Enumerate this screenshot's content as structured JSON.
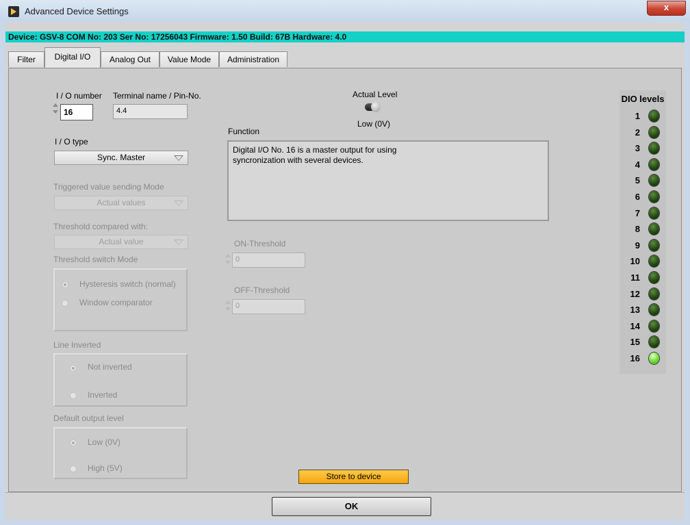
{
  "window": {
    "title": "Advanced Device Settings",
    "close_label": "x"
  },
  "device_info": "Device: GSV-8 COM No: 203 Ser No: 17256043 Firmware: 1.50 Build: 67B Hardware: 4.0",
  "tabs": [
    {
      "label": "Filter",
      "active": false
    },
    {
      "label": "Digital I/O",
      "active": true
    },
    {
      "label": "Analog Out",
      "active": false
    },
    {
      "label": "Value Mode",
      "active": false
    },
    {
      "label": "Administration",
      "active": false
    }
  ],
  "io": {
    "number_label": "I / O number",
    "number_value": "16",
    "terminal_label": "Terminal name / Pin-No.",
    "terminal_value": "4.4",
    "type_label": "I / O type",
    "type_value": "Sync. Master"
  },
  "triggered": {
    "label": "Triggered value sending Mode",
    "value": "Actual values"
  },
  "threshold_compare": {
    "label": "Threshold compared with:",
    "value": "Actual value"
  },
  "threshold_switch": {
    "label": "Threshold switch Mode",
    "options": [
      "Hysteresis switch (normal)",
      "Window comparator"
    ],
    "selected": 0
  },
  "line_inverted": {
    "label": "Line Inverted",
    "options": [
      "Not inverted",
      "Inverted"
    ],
    "selected": 0
  },
  "default_output": {
    "label": "Default output level",
    "options": [
      "Low (0V)",
      "High (5V)"
    ],
    "selected": 0
  },
  "actual_level": {
    "label": "Actual Level",
    "value": "Low (0V)"
  },
  "function": {
    "label": "Function",
    "text": "Digital I/O No. 16 is a  master output for using\nsyncronization with several devices."
  },
  "on_threshold": {
    "label": "ON-Threshold",
    "value": "0"
  },
  "off_threshold": {
    "label": "OFF-Threshold",
    "value": "0"
  },
  "dio": {
    "title": "DIO levels",
    "levels": [
      {
        "num": "1",
        "on": false
      },
      {
        "num": "2",
        "on": false
      },
      {
        "num": "3",
        "on": false
      },
      {
        "num": "4",
        "on": false
      },
      {
        "num": "5",
        "on": false
      },
      {
        "num": "6",
        "on": false
      },
      {
        "num": "7",
        "on": false
      },
      {
        "num": "8",
        "on": false
      },
      {
        "num": "9",
        "on": false
      },
      {
        "num": "10",
        "on": false
      },
      {
        "num": "11",
        "on": false
      },
      {
        "num": "12",
        "on": false
      },
      {
        "num": "13",
        "on": false
      },
      {
        "num": "14",
        "on": false
      },
      {
        "num": "15",
        "on": false
      },
      {
        "num": "16",
        "on": true
      }
    ]
  },
  "buttons": {
    "store": "Store to device",
    "ok": "OK"
  },
  "colors": {
    "device_bar": "#14d0c6",
    "store_button": "#f5a60c",
    "led_on": "#7ae34a",
    "led_off": "#1d4612"
  }
}
